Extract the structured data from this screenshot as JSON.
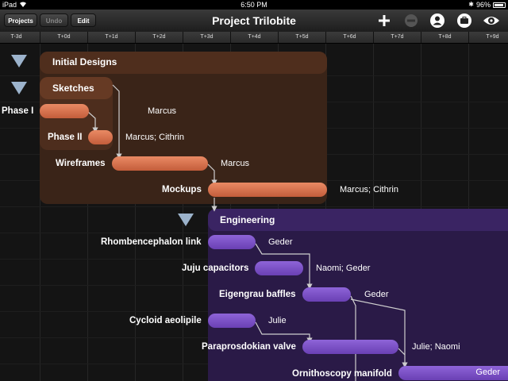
{
  "status": {
    "device": "iPad",
    "time": "6:50 PM",
    "battery": "96%"
  },
  "toolbar": {
    "projects_label": "Projects",
    "undo_label": "Undo",
    "edit_label": "Edit",
    "title": "Project Trilobite"
  },
  "timeline": [
    "T-3d",
    "T+0d",
    "T+1d",
    "T+2d",
    "T+3d",
    "T+4d",
    "T+5d",
    "T+6d",
    "T+7d",
    "T+8d",
    "T+9d"
  ],
  "groups": {
    "initial_designs": "Initial Designs",
    "sketches": "Sketches",
    "engineering": "Engineering"
  },
  "tasks": {
    "phase1": {
      "name": "Phase I",
      "resources": "Marcus"
    },
    "phase2": {
      "name": "Phase II",
      "resources": "Marcus; Cithrin"
    },
    "wireframes": {
      "name": "Wireframes",
      "resources": "Marcus"
    },
    "mockups": {
      "name": "Mockups",
      "resources": "Marcus; Cithrin"
    },
    "rhombencephalon": {
      "name": "Rhombencephalon link",
      "resources": "Geder"
    },
    "juju": {
      "name": "Juju capacitors",
      "resources": "Naomi; Geder"
    },
    "eigengrau": {
      "name": "Eigengrau baffles",
      "resources": "Geder"
    },
    "cycloid": {
      "name": "Cycloid aeolipile",
      "resources": "Julie"
    },
    "paraprosdokian": {
      "name": "Paraprosdokian valve",
      "resources": "Julie; Naomi"
    },
    "ornithoscopy": {
      "name": "Ornithoscopy manifold",
      "resources": "Geder"
    }
  },
  "colors": {
    "design_bar": "#d9714b",
    "engineering_bar": "#7b52c6",
    "design_group": "#3a2418",
    "engineering_group": "#2a1a47",
    "disclosure": "#9cb3cc"
  }
}
